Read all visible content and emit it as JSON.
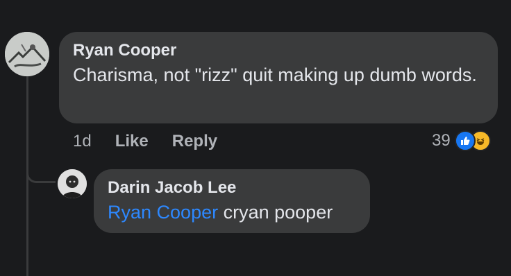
{
  "comment": {
    "author": "Ryan Cooper",
    "text": "Charisma, not \"rizz\" quit making up dumb words.",
    "time": "1d",
    "like_label": "Like",
    "reply_label": "Reply",
    "reaction_count": "39",
    "reaction_icons": [
      "like-icon",
      "haha-icon"
    ]
  },
  "reply": {
    "author": "Darin Jacob Lee",
    "mention": "Ryan Cooper",
    "text": "cryan pooper"
  },
  "colors": {
    "background": "#1a1b1d",
    "bubble": "#3a3b3c",
    "text": "#e4e6eb",
    "muted": "#b0b3b8",
    "mention": "#2d88ff"
  }
}
